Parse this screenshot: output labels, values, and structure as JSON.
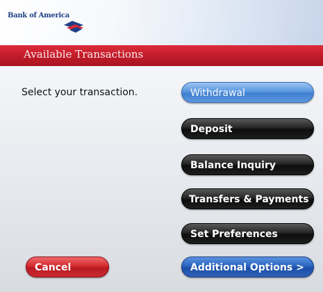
{
  "brand": {
    "name": "Bank of America"
  },
  "screen": {
    "title": "Available Transactions",
    "prompt": "Select your transaction."
  },
  "buttons": {
    "withdrawal": "Withdrawal",
    "deposit": "Deposit",
    "balance_inquiry": "Balance Inquiry",
    "transfers_payments": "Transfers & Payments",
    "set_preferences": "Set Preferences",
    "additional_options": "Additional Options >",
    "cancel": "Cancel"
  },
  "colors": {
    "title_bar": "#c61d2b",
    "brand_blue": "#1d3f86",
    "selected_button": "#5a98e0",
    "dark_button": "#1e1e1e",
    "cancel_button": "#c92a30"
  }
}
